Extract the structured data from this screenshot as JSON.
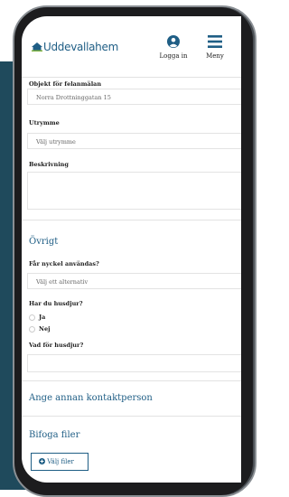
{
  "header": {
    "logo_text": "Uddevallahem",
    "login_label": "Logga in",
    "menu_label": "Meny"
  },
  "form": {
    "object_label": "Objekt för felanmälan",
    "object_value": "Norra Drottninggatan 15",
    "space_label": "Utrymme",
    "space_placeholder": "Välj utrymme",
    "description_label": "Beskrivning"
  },
  "other": {
    "heading": "Övrigt",
    "key_label": "Får nyckel användas?",
    "key_placeholder": "Välj ett alternativ",
    "pets_label": "Har du husdjur?",
    "pets_options": [
      "Ja",
      "Nej"
    ],
    "which_pets_label": "Vad för husdjur?"
  },
  "contact": {
    "heading": "Ange annan kontaktperson"
  },
  "files": {
    "heading": "Bifoga filer",
    "button_label": "Välj filer"
  },
  "colors": {
    "brand": "#1f5e85",
    "background": "#1f4a5c"
  }
}
